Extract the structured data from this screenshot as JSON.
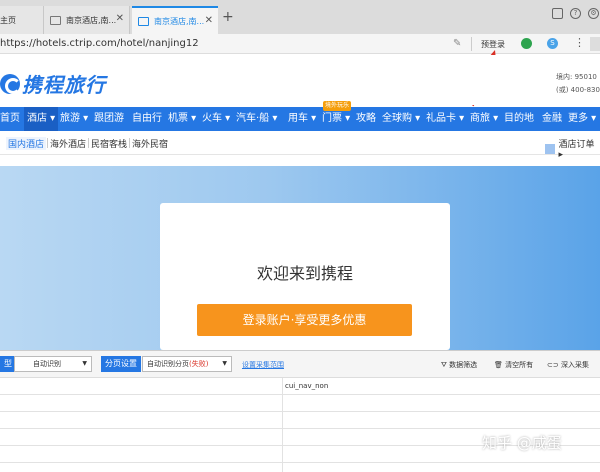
{
  "browser": {
    "tabs": [
      {
        "label": "主页"
      },
      {
        "label": "南京酒店,南..."
      },
      {
        "label": "南京酒店,南..."
      }
    ],
    "url": "https://hotels.ctrip.com/hotel/nanjing12",
    "pre_login": "预登录",
    "ext_blue_glyph": "S"
  },
  "site": {
    "logo_text": "携程旅行",
    "hotline_line1": "境内: 95010",
    "hotline_line2": "(或) 400-830-6666",
    "nav": [
      {
        "label": "首页"
      },
      {
        "label": "酒店 ▾"
      },
      {
        "label": "旅游 ▾"
      },
      {
        "label": "跟团游"
      },
      {
        "label": "自由行"
      },
      {
        "label": "机票 ▾"
      },
      {
        "label": "火车 ▾"
      },
      {
        "label": "汽车·船 ▾"
      },
      {
        "label": "用车 ▾"
      },
      {
        "label": "门票 ▾"
      },
      {
        "label": "攻略"
      },
      {
        "label": "全球购 ▾"
      },
      {
        "label": "礼品卡 ▾"
      },
      {
        "label": "商旅 ▾"
      },
      {
        "label": "目的地"
      },
      {
        "label": "金融"
      },
      {
        "label": "更多 ▾"
      }
    ],
    "nav_badge": "境外玩乐",
    "subnav": [
      {
        "label": "国内酒店"
      },
      {
        "label": "海外酒店"
      },
      {
        "label": "民宿客栈"
      },
      {
        "label": "海外民宿"
      }
    ],
    "order_link": "酒店订单 ▸"
  },
  "modal": {
    "title": "欢迎来到携程",
    "button": "登录账户·享受更多优惠"
  },
  "collector": {
    "type_label": "型",
    "type_value": "自动识别",
    "paging_label": "分页设置",
    "paging_value_prefix": "自动识别分页",
    "paging_value_status": "(失败)",
    "range_link": "设置采集范围",
    "actions": [
      {
        "label": "数据筛选"
      },
      {
        "label": "清空所有"
      },
      {
        "label": "深入采集"
      }
    ],
    "column_header": "cui_nav_non"
  },
  "watermark": "知乎 @咸蛋"
}
